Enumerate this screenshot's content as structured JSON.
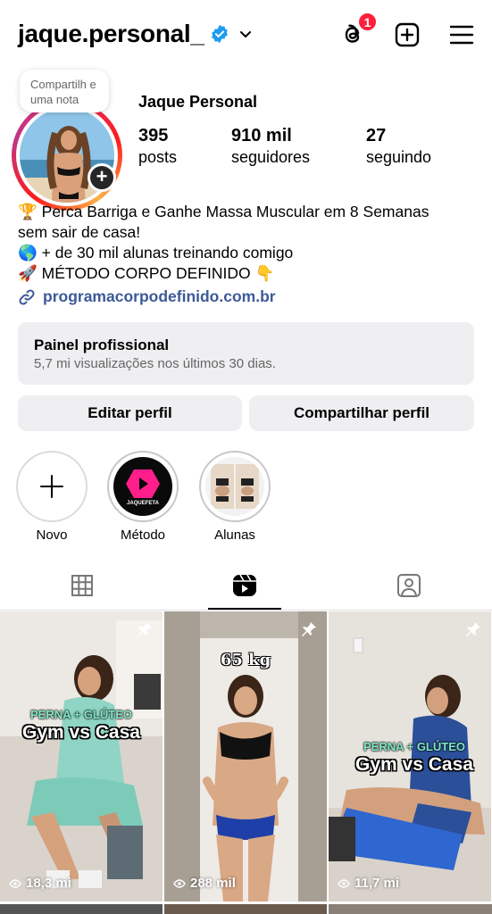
{
  "header": {
    "username": "jaque.personal_",
    "threads_badge": "1",
    "icons": [
      "verified-badge-icon",
      "chevron-down-icon",
      "threads-icon",
      "new-post-icon",
      "menu-icon"
    ]
  },
  "profile": {
    "note": "Compartilh e uma nota",
    "display_name": "Jaque Personal",
    "stats": [
      {
        "value": "395",
        "label": "posts"
      },
      {
        "value": "910 mil",
        "label": "seguidores"
      },
      {
        "value": "27",
        "label": "seguindo"
      }
    ],
    "add_story": "+"
  },
  "bio": {
    "lines": [
      "🏆 Perca Barriga e Ganhe Massa Muscular em 8 Semanas",
      "sem sair de casa!",
      "🌎 + de 30 mil alunas treinando comigo",
      "🚀 MÉTODO CORPO DEFINIDO 👇"
    ],
    "link": "programacorpodefinido.com.br"
  },
  "pro_panel": {
    "title": "Painel profissional",
    "subtitle": "5,7 mi visualizações nos últimos 30 dias."
  },
  "buttons": {
    "edit": "Editar perfil",
    "share": "Compartilhar perfil"
  },
  "highlights": [
    {
      "label": "Novo",
      "icon": "plus-icon"
    },
    {
      "label": "Método",
      "logo_text": "JAQUEFETA"
    },
    {
      "label": "Alunas"
    }
  ],
  "tabs": [
    "grid-icon",
    "reels-icon",
    "tagged-icon"
  ],
  "active_tab": "reels",
  "posts": [
    {
      "views": "18,3 mi",
      "overlay_small": "PERNA + GLÚTEO",
      "overlay_big": "Gym vs Casa"
    },
    {
      "views": "288 mil",
      "overlay_weight": "65 kg"
    },
    {
      "views": "11,7 mi",
      "overlay_small": "PERNA + GLÚTEO",
      "overlay_big": "Gym vs Casa"
    }
  ],
  "colors": {
    "accent_link": "#385898",
    "badge": "#ff1e3c",
    "verified": "#1d9bf0",
    "panel_bg": "#efeff2"
  }
}
